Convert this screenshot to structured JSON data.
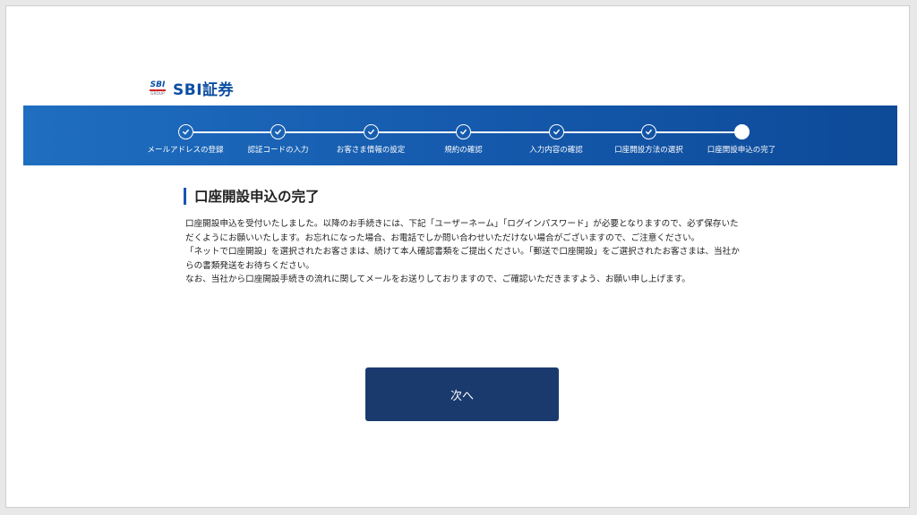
{
  "header": {
    "logo_mark": "SBI",
    "logo_group": "GROUP",
    "logo_text": "SBI証券"
  },
  "steps": [
    {
      "label": "メールアドレスの登録",
      "status": "done"
    },
    {
      "label": "認証コードの入力",
      "status": "done"
    },
    {
      "label": "お客さま情報の設定",
      "status": "done"
    },
    {
      "label": "規約の確認",
      "status": "done"
    },
    {
      "label": "入力内容の確認",
      "status": "done"
    },
    {
      "label": "口座開設方法の選択",
      "status": "done"
    },
    {
      "label": "口座開設申込の完了",
      "status": "current"
    }
  ],
  "main": {
    "title": "口座開設申込の完了",
    "paragraphs": [
      "口座開設申込を受付いたしました。以降のお手続きには、下記「ユーザーネーム」「ログインパスワード」が必要となりますので、必ず保存いただくようにお願いいたします。お忘れになった場合、お電話でしか問い合わせいただけない場合がございますので、ご注意ください。",
      "「ネットで口座開設」を選択されたお客さまは、続けて本人確認書類をご提出ください。「郵送で口座開設」をご選択されたお客さまは、当社からの書類発送をお待ちください。",
      "なお、当社から口座開設手続きの流れに関してメールをお送りしておりますので、ご確認いただきますよう、お願い申し上げます。"
    ],
    "next_label": "次へ"
  },
  "colors": {
    "brand_blue": "#0b4ea2",
    "stepper_bg": "#155aad",
    "button_bg": "#1a3a6e",
    "accent_red": "#d2232a"
  }
}
